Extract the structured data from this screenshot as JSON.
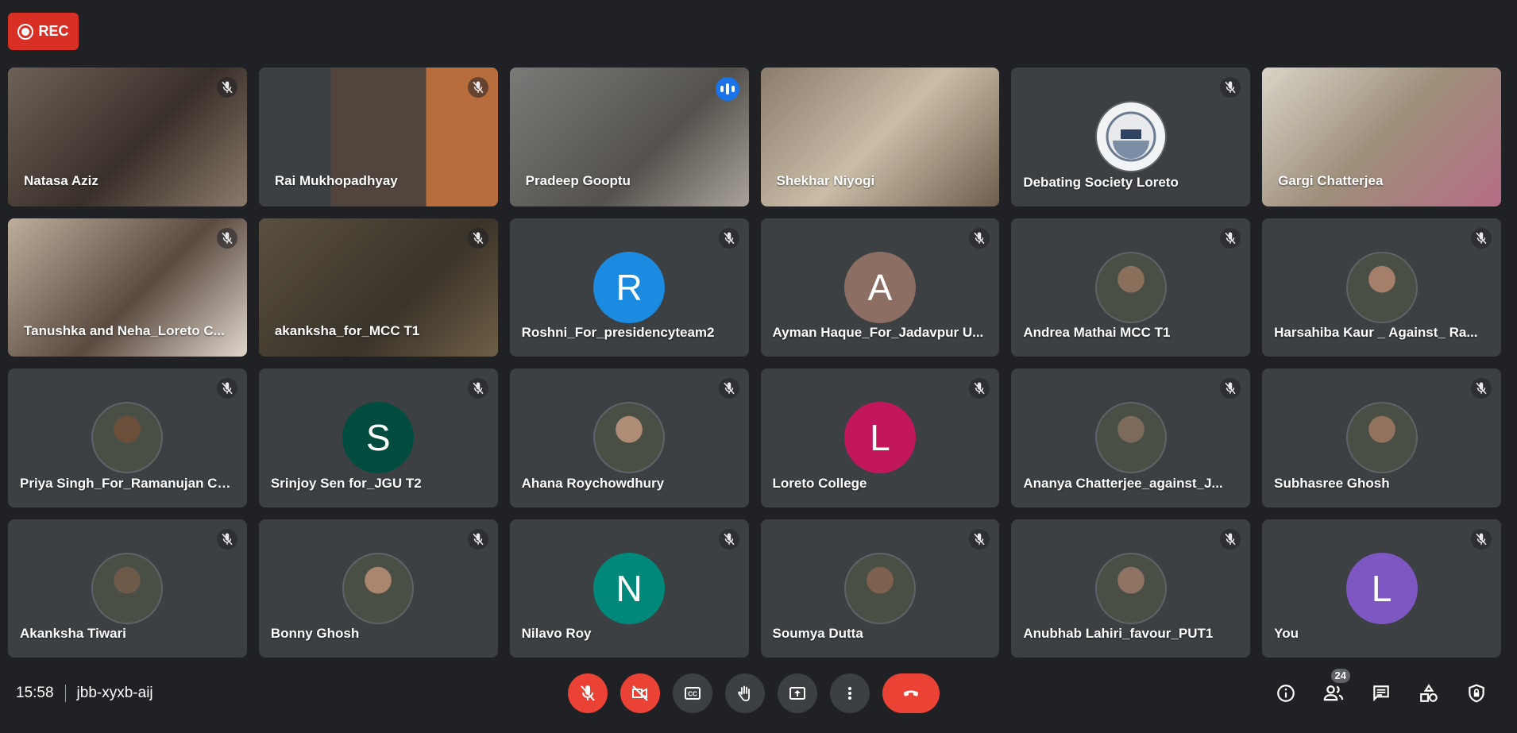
{
  "recording": {
    "label": "REC"
  },
  "meeting": {
    "time": "15:58",
    "code": "jbb-xyxb-aij",
    "participant_count": "24"
  },
  "participants": [
    {
      "name": "Natasa Aziz",
      "kind": "video",
      "mic": "off"
    },
    {
      "name": "Rai Mukhopadhyay",
      "kind": "video",
      "mic": "off"
    },
    {
      "name": "Pradeep Gooptu",
      "kind": "video",
      "mic": "speaking",
      "active": true
    },
    {
      "name": "Shekhar Niyogi",
      "kind": "video",
      "mic": "none"
    },
    {
      "name": "Debating Society Loreto",
      "kind": "logo",
      "mic": "off"
    },
    {
      "name": "Gargi Chatterjea",
      "kind": "video",
      "mic": "none"
    },
    {
      "name": "Tanushka and Neha_Loreto C...",
      "kind": "video",
      "mic": "off"
    },
    {
      "name": "akanksha_for_MCC T1",
      "kind": "video",
      "mic": "off"
    },
    {
      "name": "Roshni_For_presidencyteam2",
      "kind": "initial",
      "initial": "R",
      "color": "#1a8be0",
      "mic": "off"
    },
    {
      "name": "Ayman Haque_For_Jadavpur U...",
      "kind": "initial",
      "initial": "A",
      "color": "#8d6e63",
      "mic": "off"
    },
    {
      "name": "Andrea Mathai MCC T1",
      "kind": "photo",
      "mic": "off"
    },
    {
      "name": "Harsahiba Kaur _ Against_ Ra...",
      "kind": "photo",
      "mic": "off"
    },
    {
      "name": "Priya Singh_For_Ramanujan Co...",
      "kind": "photo",
      "mic": "off"
    },
    {
      "name": "Srinjoy Sen for_JGU T2",
      "kind": "initial",
      "initial": "S",
      "color": "#004d40",
      "mic": "off"
    },
    {
      "name": "Ahana Roychowdhury",
      "kind": "photo",
      "mic": "off"
    },
    {
      "name": "Loreto College",
      "kind": "initial",
      "initial": "L",
      "color": "#c2185b",
      "mic": "off"
    },
    {
      "name": "Ananya Chatterjee_against_J...",
      "kind": "photo",
      "mic": "off"
    },
    {
      "name": "Subhasree Ghosh",
      "kind": "photo",
      "mic": "off"
    },
    {
      "name": "Akanksha Tiwari",
      "kind": "photo",
      "mic": "off"
    },
    {
      "name": "Bonny Ghosh",
      "kind": "photo",
      "mic": "off"
    },
    {
      "name": "Nilavo Roy",
      "kind": "initial",
      "initial": "N",
      "color": "#00897b",
      "mic": "off"
    },
    {
      "name": "Soumya Dutta",
      "kind": "photo",
      "mic": "off"
    },
    {
      "name": "Anubhab Lahiri_favour_PUT1",
      "kind": "photo",
      "mic": "off"
    },
    {
      "name": "You",
      "kind": "initial",
      "initial": "L",
      "color": "#7e57c2",
      "mic": "off"
    }
  ],
  "controls": [
    {
      "id": "mic",
      "icon": "mic-off-icon"
    },
    {
      "id": "camera",
      "icon": "camera-off-icon"
    },
    {
      "id": "captions",
      "icon": "closed-captions-icon"
    },
    {
      "id": "raise-hand",
      "icon": "hand-icon"
    },
    {
      "id": "present",
      "icon": "present-screen-icon"
    },
    {
      "id": "more",
      "icon": "more-vert-icon"
    },
    {
      "id": "leave",
      "icon": "hang-up-icon"
    }
  ],
  "tools": [
    {
      "id": "info",
      "icon": "info-icon"
    },
    {
      "id": "people",
      "icon": "people-icon"
    },
    {
      "id": "chat",
      "icon": "chat-icon"
    },
    {
      "id": "activities",
      "icon": "shapes-icon"
    },
    {
      "id": "host-controls",
      "icon": "lock-shield-icon"
    }
  ],
  "colors": {
    "background": "#202124",
    "tile": "#3c4043",
    "accent": "#1a73e8",
    "danger": "#ea4335"
  }
}
